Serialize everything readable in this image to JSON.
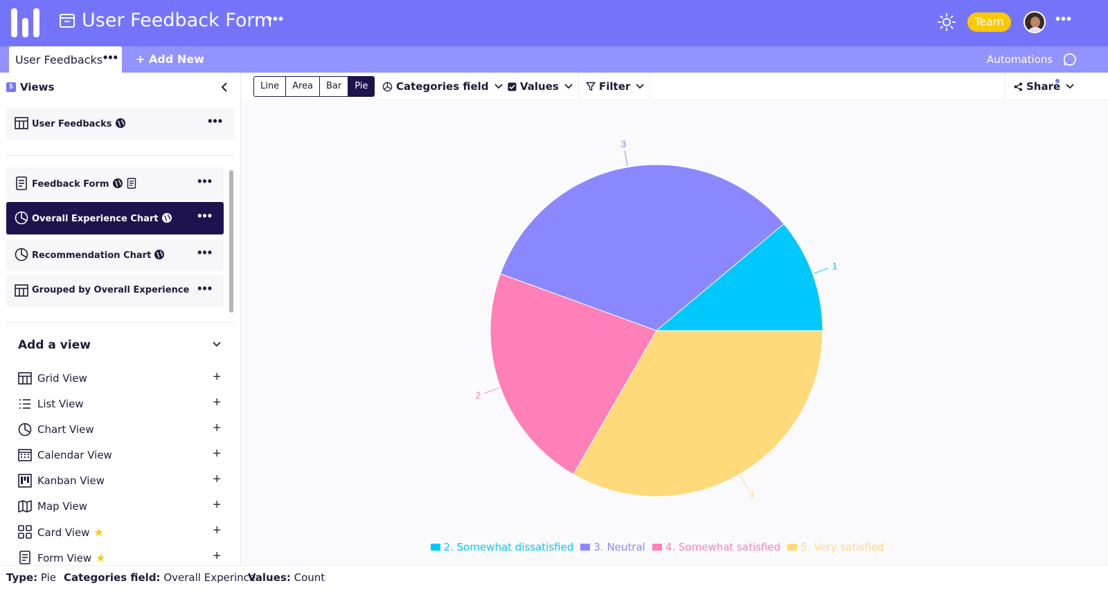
{
  "header": {
    "title": "User Feedback Form",
    "more": "•••",
    "team_label": "Team",
    "top_more": "•••"
  },
  "tabs": {
    "active_label": "User Feedbacks",
    "active_more": "•••",
    "add_new": "+ Add New",
    "automations": "Automations"
  },
  "sidebar": {
    "views_count": "5",
    "views_title": "Views",
    "views": [
      {
        "label": "User Feedbacks",
        "type": "grid",
        "public": true,
        "active": false
      },
      {
        "label": "Feedback Form",
        "type": "form",
        "public": true,
        "active": false
      },
      {
        "label": "Overall Experience Chart",
        "type": "chart",
        "public": true,
        "active": true
      },
      {
        "label": "Recommendation Chart",
        "type": "chart",
        "public": true,
        "active": false
      },
      {
        "label": "Grouped by Overall Experience",
        "type": "grid",
        "public": false,
        "active": false
      }
    ],
    "item_more": "•••",
    "add_view_title": "Add a view",
    "add_views": [
      {
        "label": "Grid View",
        "icon": "grid-icon",
        "premium": false
      },
      {
        "label": "List View",
        "icon": "list-icon",
        "premium": false
      },
      {
        "label": "Chart View",
        "icon": "chart-icon",
        "premium": false
      },
      {
        "label": "Calendar View",
        "icon": "calendar-icon",
        "premium": false
      },
      {
        "label": "Kanban View",
        "icon": "kanban-icon",
        "premium": false
      },
      {
        "label": "Map View",
        "icon": "map-icon",
        "premium": false
      },
      {
        "label": "Card View",
        "icon": "card-icon",
        "premium": true
      },
      {
        "label": "Form View",
        "icon": "form-icon",
        "premium": true
      }
    ],
    "plus": "+",
    "star": "★"
  },
  "toolbar": {
    "chart_types": [
      "Line",
      "Area",
      "Bar",
      "Pie"
    ],
    "active_chart_type": "Pie",
    "categories_field": "Categories field",
    "values": "Values",
    "filter": "Filter",
    "share": "Share"
  },
  "chart_data": {
    "type": "pie",
    "categories": [
      "2. Somewhat dissatisfied",
      "3. Neutral",
      "4. Somewhat satisfied",
      "5. Very satisfied"
    ],
    "values": [
      1,
      3,
      2,
      3
    ],
    "colors": [
      "#00c8fb",
      "#8b88ff",
      "#ff7fb8",
      "#ffda7a"
    ],
    "data_labels": [
      "1",
      "3",
      "2",
      "3"
    ],
    "legend_position": "bottom"
  },
  "status": {
    "type_label": "Type:",
    "type_value": "Pie",
    "categories_label": "Categories field:",
    "categories_value": "Overall Experince",
    "values_label": "Values:",
    "values_value": "Count"
  },
  "colors": {
    "header": "#7474fb",
    "tabbar": "#9393ff",
    "active_dark": "#20124d",
    "team": "#fcc800"
  }
}
